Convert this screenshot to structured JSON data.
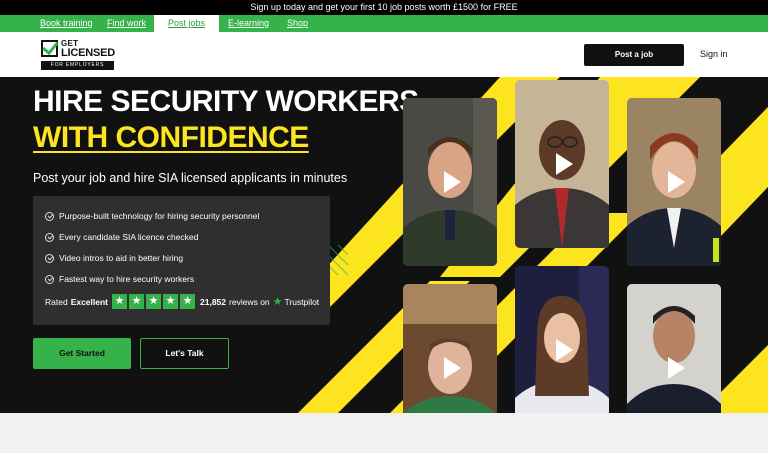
{
  "announcement": "Sign up today and get your first 10 job posts worth £1500 for FREE",
  "nav": {
    "items": [
      {
        "label": "Book training"
      },
      {
        "label": "Find work"
      },
      {
        "label": "Post jobs",
        "active": true
      },
      {
        "label": "E-learning"
      },
      {
        "label": "Shop"
      }
    ]
  },
  "logo": {
    "line1": "GET",
    "line2": "LICENSED",
    "line3": "FOR EMPLOYERS"
  },
  "header": {
    "post_job": "Post a job",
    "sign_in": "Sign in"
  },
  "hero": {
    "title_line1": "HIRE SECURITY WORKERS",
    "title_line2": "WITH CONFIDENCE",
    "subtitle": "Post your job and hire SIA licensed applicants in minutes",
    "features": [
      "Purpose-built technology for hiring security personnel",
      "Every candidate SIA licence checked",
      "Video intros to aid in better hiring",
      "Fastest way to hire security workers"
    ],
    "rating": {
      "prefix": "Rated",
      "label": "Excellent",
      "stars": 5,
      "count": "21,852",
      "suffix": "reviews on",
      "source": "Trustpilot"
    },
    "cta_primary": "Get Started",
    "cta_secondary": "Let's Talk"
  },
  "colors": {
    "green": "#35b24a",
    "yellow": "#fce51f",
    "dark": "#111111"
  },
  "video_cards": [
    {
      "name": "video-card-1",
      "icon": "play-icon"
    },
    {
      "name": "video-card-2",
      "icon": "play-icon"
    },
    {
      "name": "video-card-3",
      "icon": "play-icon"
    },
    {
      "name": "video-card-4",
      "icon": "play-icon"
    },
    {
      "name": "video-card-5",
      "icon": "play-icon"
    },
    {
      "name": "video-card-6",
      "icon": "play-icon"
    }
  ]
}
